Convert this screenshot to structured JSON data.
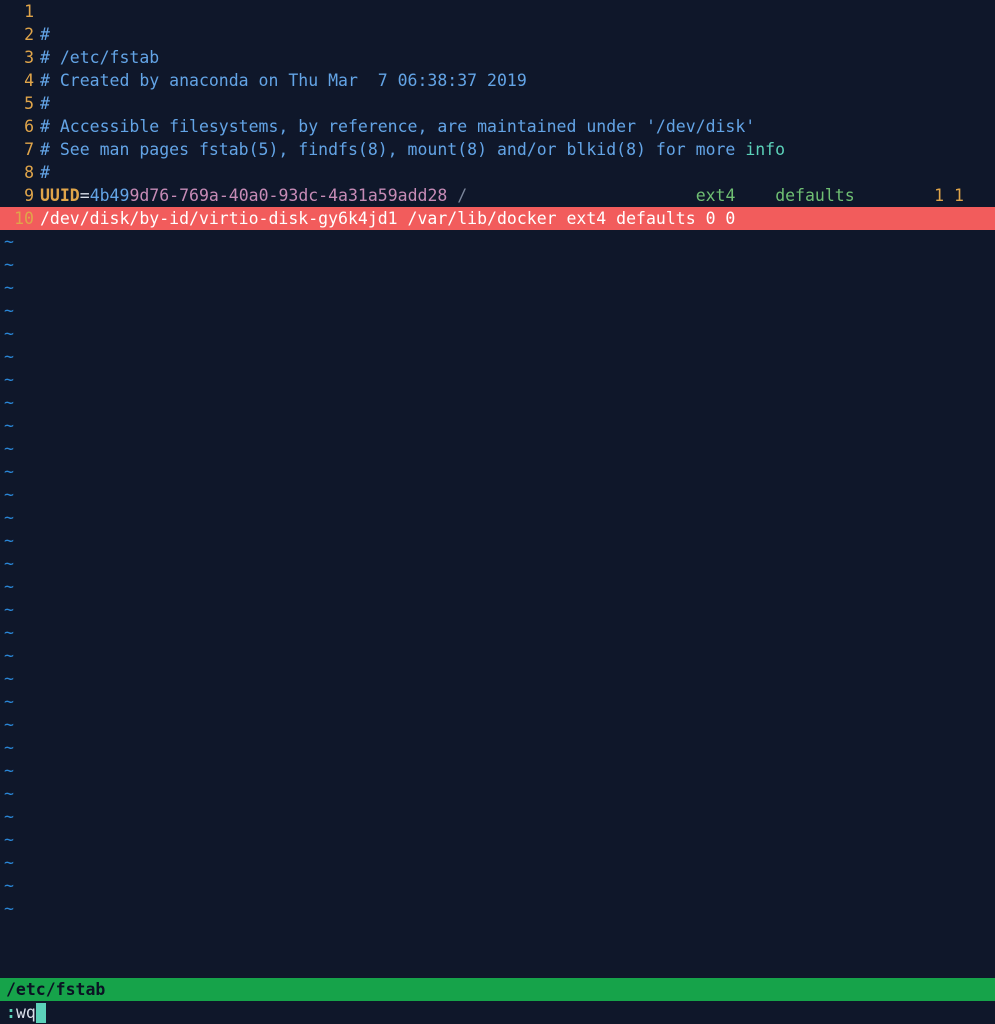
{
  "lines": [
    {
      "n": "1",
      "segments": []
    },
    {
      "n": "2",
      "segments": [
        {
          "cls": "comment",
          "t": "#"
        }
      ]
    },
    {
      "n": "3",
      "segments": [
        {
          "cls": "comment",
          "t": "# /etc/fstab"
        }
      ]
    },
    {
      "n": "4",
      "segments": [
        {
          "cls": "comment",
          "t": "# Created by anaconda on Thu Mar  7 06:38:37 2019"
        }
      ]
    },
    {
      "n": "5",
      "segments": [
        {
          "cls": "comment",
          "t": "#"
        }
      ]
    },
    {
      "n": "6",
      "segments": [
        {
          "cls": "comment",
          "t": "# Accessible filesystems, by reference, are maintained under '/dev/disk'"
        }
      ]
    },
    {
      "n": "7",
      "segments": [
        {
          "cls": "comment",
          "t": "# See man pages fstab(5), findfs(8), mount(8) and/or blkid(8) for more "
        },
        {
          "cls": "keyword-info",
          "t": "info"
        }
      ]
    },
    {
      "n": "8",
      "segments": [
        {
          "cls": "comment",
          "t": "#"
        }
      ]
    },
    {
      "n": "9",
      "segments": [
        {
          "cls": "uuid-key",
          "t": "UUID"
        },
        {
          "cls": "uuid-eq",
          "t": "="
        },
        {
          "cls": "uuid-val1",
          "t": "4b49"
        },
        {
          "cls": "uuid-val2",
          "t": "9d76-769a-40a0-93dc-4a31a59add28"
        },
        {
          "cls": "fs-root",
          "t": " /                       "
        },
        {
          "cls": "fs-type",
          "t": "ext4"
        },
        {
          "cls": "",
          "t": "    "
        },
        {
          "cls": "fs-opts",
          "t": "defaults"
        },
        {
          "cls": "",
          "t": "        "
        },
        {
          "cls": "fs-dump",
          "t": "1 1"
        }
      ]
    },
    {
      "n": "10",
      "highlight": true,
      "segments": [
        {
          "cls": "",
          "t": "/dev/disk/by-id/virtio-disk-gy6k4jd1 /var/lib/docker ext4 defaults 0 0"
        }
      ]
    }
  ],
  "empty_rows": 30,
  "tilde": "~",
  "statusbar": "/etc/fstab",
  "command": {
    "colon": ":",
    "text": "wq"
  }
}
